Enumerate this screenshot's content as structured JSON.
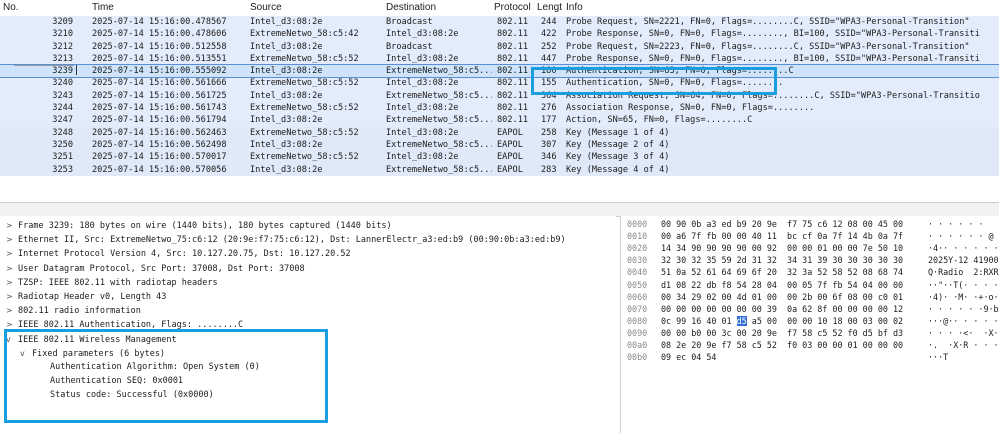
{
  "columns": {
    "no": "No.",
    "time": "Time",
    "source": "Source",
    "destination": "Destination",
    "protocol": "Protocol",
    "length": "Lengt",
    "info": "Info"
  },
  "packets": [
    {
      "no": "3209",
      "time": "2025-07-14 15:16:00.478567",
      "src": "Intel_d3:08:2e",
      "dst": "Broadcast",
      "proto": "802.11",
      "len": "244",
      "info": "Probe Request, SN=2221, FN=0, Flags=........C, SSID=\"WPA3-Personal-Transition\""
    },
    {
      "no": "3210",
      "time": "2025-07-14 15:16:00.478606",
      "src": "ExtremeNetwo_58:c5:42",
      "dst": "Intel_d3:08:2e",
      "proto": "802.11",
      "len": "422",
      "info": "Probe Response, SN=0, FN=0, Flags=........, BI=100, SSID=\"WPA3-Personal-Transiti"
    },
    {
      "no": "3212",
      "time": "2025-07-14 15:16:00.512558",
      "src": "Intel_d3:08:2e",
      "dst": "Broadcast",
      "proto": "802.11",
      "len": "252",
      "info": "Probe Request, SN=2223, FN=0, Flags=........C, SSID=\"WPA3-Personal-Transition\""
    },
    {
      "no": "3213",
      "time": "2025-07-14 15:16:00.513551",
      "src": "ExtremeNetwo_58:c5:52",
      "dst": "Intel_d3:08:2e",
      "proto": "802.11",
      "len": "447",
      "info": "Probe Response, SN=0, FN=0, Flags=........, BI=100, SSID=\"WPA3-Personal-Transiti"
    },
    {
      "no": "3239",
      "time": "2025-07-14 15:16:00.555092",
      "src": "Intel_d3:08:2e",
      "dst": "ExtremeNetwo_58:c5...",
      "proto": "802.11",
      "len": "180",
      "info": "Authentication, SN=63, FN=0, Flags=........C"
    },
    {
      "no": "3240",
      "time": "2025-07-14 15:16:00.561666",
      "src": "ExtremeNetwo_58:c5:52",
      "dst": "Intel_d3:08:2e",
      "proto": "802.11",
      "len": "155",
      "info": "Authentication, SN=0, FN=0, Flags=........"
    },
    {
      "no": "3243",
      "time": "2025-07-14 15:16:00.561725",
      "src": "Intel_d3:08:2e",
      "dst": "ExtremeNetwo_58:c5...",
      "proto": "802.11",
      "len": "364",
      "info": "Association Request, SN=64, FN=0, Flags=........C, SSID=\"WPA3-Personal-Transitio"
    },
    {
      "no": "3244",
      "time": "2025-07-14 15:16:00.561743",
      "src": "ExtremeNetwo_58:c5:52",
      "dst": "Intel_d3:08:2e",
      "proto": "802.11",
      "len": "276",
      "info": "Association Response, SN=0, FN=0, Flags=........"
    },
    {
      "no": "3247",
      "time": "2025-07-14 15:16:00.561794",
      "src": "Intel_d3:08:2e",
      "dst": "ExtremeNetwo_58:c5...",
      "proto": "802.11",
      "len": "177",
      "info": "Action, SN=65, FN=0, Flags=........C"
    },
    {
      "no": "3248",
      "time": "2025-07-14 15:16:00.562463",
      "src": "ExtremeNetwo_58:c5:52",
      "dst": "Intel_d3:08:2e",
      "proto": "EAPOL",
      "len": "258",
      "info": "Key (Message 1 of 4)"
    },
    {
      "no": "3250",
      "time": "2025-07-14 15:16:00.562498",
      "src": "Intel_d3:08:2e",
      "dst": "ExtremeNetwo_58:c5...",
      "proto": "EAPOL",
      "len": "307",
      "info": "Key (Message 2 of 4)"
    },
    {
      "no": "3251",
      "time": "2025-07-14 15:16:00.570017",
      "src": "ExtremeNetwo_58:c5:52",
      "dst": "Intel_d3:08:2e",
      "proto": "EAPOL",
      "len": "346",
      "info": "Key (Message 3 of 4)"
    },
    {
      "no": "3253",
      "time": "2025-07-14 15:16:00.570056",
      "src": "Intel_d3:08:2e",
      "dst": "ExtremeNetwo_58:c5...",
      "proto": "EAPOL",
      "len": "283",
      "info": "Key (Message 4 of 4)"
    }
  ],
  "selected_packet_no": "3239",
  "details": [
    {
      "text": "Frame 3239: 180 bytes on wire (1440 bits), 180 bytes captured (1440 bits)",
      "arrow": ">"
    },
    {
      "text": "Ethernet II, Src: ExtremeNetwo_75:c6:12 (20:9e:f7:75:c6:12), Dst: LannerElectr_a3:ed:b9 (00:90:0b:a3:ed:b9)",
      "arrow": ">"
    },
    {
      "text": "Internet Protocol Version 4, Src: 10.127.20.75, Dst: 10.127.20.52",
      "arrow": ">"
    },
    {
      "text": "User Datagram Protocol, Src Port: 37008, Dst Port: 37008",
      "arrow": ">"
    },
    {
      "text": "TZSP: IEEE 802.11 with radiotap headers",
      "arrow": ">"
    },
    {
      "text": "Radiotap Header v0, Length 43",
      "arrow": ">"
    },
    {
      "text": "802.11 radio information",
      "arrow": ">"
    },
    {
      "text": "IEEE 802.11 Authentication, Flags: ........C",
      "arrow": ">"
    },
    {
      "text": "IEEE 802.11 Wireless Management",
      "arrow": "v"
    }
  ],
  "fixed_params": {
    "label": "Fixed parameters (6 bytes)",
    "arrow": "v"
  },
  "fixed_fields": [
    "Authentication Algorithm: Open System (0)",
    "Authentication SEQ: 0x0001",
    "Status code: Successful (0x0000)"
  ],
  "bytes": [
    {
      "offset": "0000",
      "hex": "00 90 0b a3 ed b9 20 9e  f7 75 c6 12 08 00 45 00",
      "ascii": "· · · · · ·   · · u · · · E ·"
    },
    {
      "offset": "0010",
      "hex": "00 a6 7f fb 00 00 40 11  bc cf 0a 7f 14 4b 0a 7f",
      "ascii": "· · · · · · @ · · · · · K · ·"
    },
    {
      "offset": "0020",
      "hex": "14 34 90 90 90 90 00 92  00 00 01 00 00 7e 50 10",
      "ascii": "·4·· · · · · · · ~P·"
    },
    {
      "offset": "0030",
      "hex": "32 30 32 35 59 2d 31 32  34 31 39 30 30 30 30 30",
      "ascii": "2025Y-12 41900000"
    },
    {
      "offset": "0040",
      "hex": "51 0a 52 61 64 69 6f 20  32 3a 52 58 52 08 68 74",
      "ascii": "Q·Radio  2:RXR·ht"
    },
    {
      "offset": "0050",
      "hex": "d1 08 22 db f8 54 28 04  00 05 7f fb 54 04 00 00",
      "ascii": "··\"··T(· · · · T · ·"
    },
    {
      "offset": "0060",
      "hex": "00 34 29 02 00 4d 01 00  00 2b 00 6f 08 00 c0 01",
      "ascii": "·4)· ·M· ·+·o· · ·"
    },
    {
      "offset": "0070",
      "hex": "00 00 00 00 00 00 00 39  0a 62 8f 00 00 00 00 12",
      "ascii": "· · · · · ·9·b· · · ·"
    },
    {
      "offset": "0080",
      "hex": "0c 99 16 40 01 d5 a5 00  00 00 10 18 00 03 00 02",
      "ascii": "···@·· · · · · · ·"
    },
    {
      "offset": "0090",
      "hex": "00 00 b0 00 3c 00 20 9e  f7 58 c5 52 f0 d5 bf d3",
      "ascii": "· · · ·<·  ·X·R· · ·"
    },
    {
      "offset": "00a0",
      "hex": "08 2e 20 9e f7 58 c5 52  f0 03 00 00 01 00 00 00",
      "ascii": "·.  ·X·R · · · · ·"
    },
    {
      "offset": "00b0",
      "hex": "09 ec 04 54",
      "ascii": "···T"
    }
  ],
  "selected_byte": {
    "row": 8,
    "hex_before": "0c 99 16 40 01 ",
    "hex_sel": "d5",
    "hex_after": " a5 00  00 00 10 18 00 03 00 02"
  },
  "colors": {
    "row_bg": "#e3ecfa",
    "highlight": "#1b9ee0",
    "selection": "#2f6fd6"
  }
}
